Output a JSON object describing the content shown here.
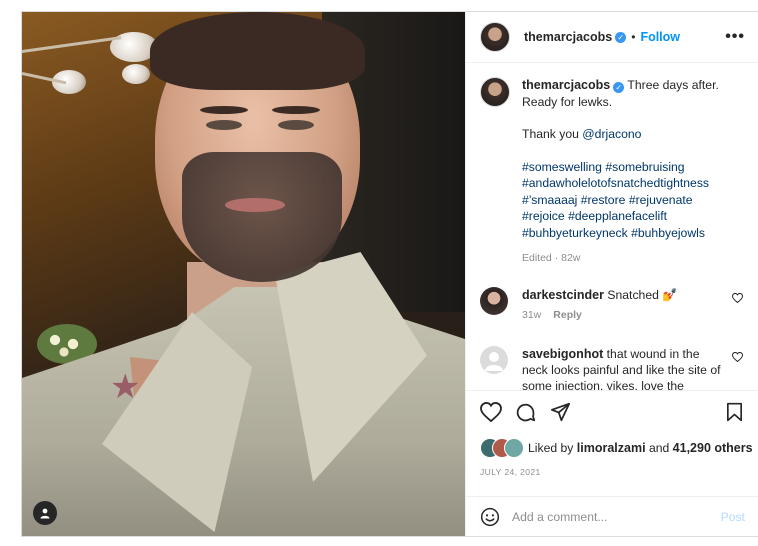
{
  "post": {
    "username": "themarcjacobs",
    "follow_label": "Follow",
    "separator": "•",
    "more_label": "•••",
    "verified_glyph": "✓"
  },
  "caption": {
    "username": "themarcjacobs",
    "line1": "Three days after.",
    "line2": "Ready for lewks.",
    "thanks_prefix": "Thank you ",
    "mention": "@drjacono",
    "hashtags": [
      "#someswelling #somebruising",
      "#andawholelotofsnatchedtightness",
      "#’smaaaaj #restore #rejuvenate",
      "#rejoice #deepplanefacelift",
      "#buhbyeturkeyneck #buhbyejowls"
    ],
    "meta": "Edited · 82w"
  },
  "comments": [
    {
      "username": "darkestcinder",
      "text": "Snatched 💅",
      "age": "31w",
      "reply_label": "Reply"
    },
    {
      "username": "savebigonhot",
      "text": "that wound in the neck looks painful and like the site of some injection. yikes. love the"
    }
  ],
  "likes": {
    "prefix": "Liked by ",
    "user": "limoralzami",
    "connector": " and ",
    "count": "41,290 others"
  },
  "date": "JULY 24, 2021",
  "add_comment": {
    "placeholder": "Add a comment...",
    "post_label": "Post"
  },
  "icons": [
    "heart-icon",
    "comment-icon",
    "share-icon",
    "bookmark-icon",
    "emoji-icon",
    "user-tag-icon",
    "more-icon"
  ],
  "colors": {
    "link": "#0095f6",
    "hashtag": "#00376b",
    "muted": "#8e8e8e",
    "post_disabled": "#b3dbff"
  }
}
